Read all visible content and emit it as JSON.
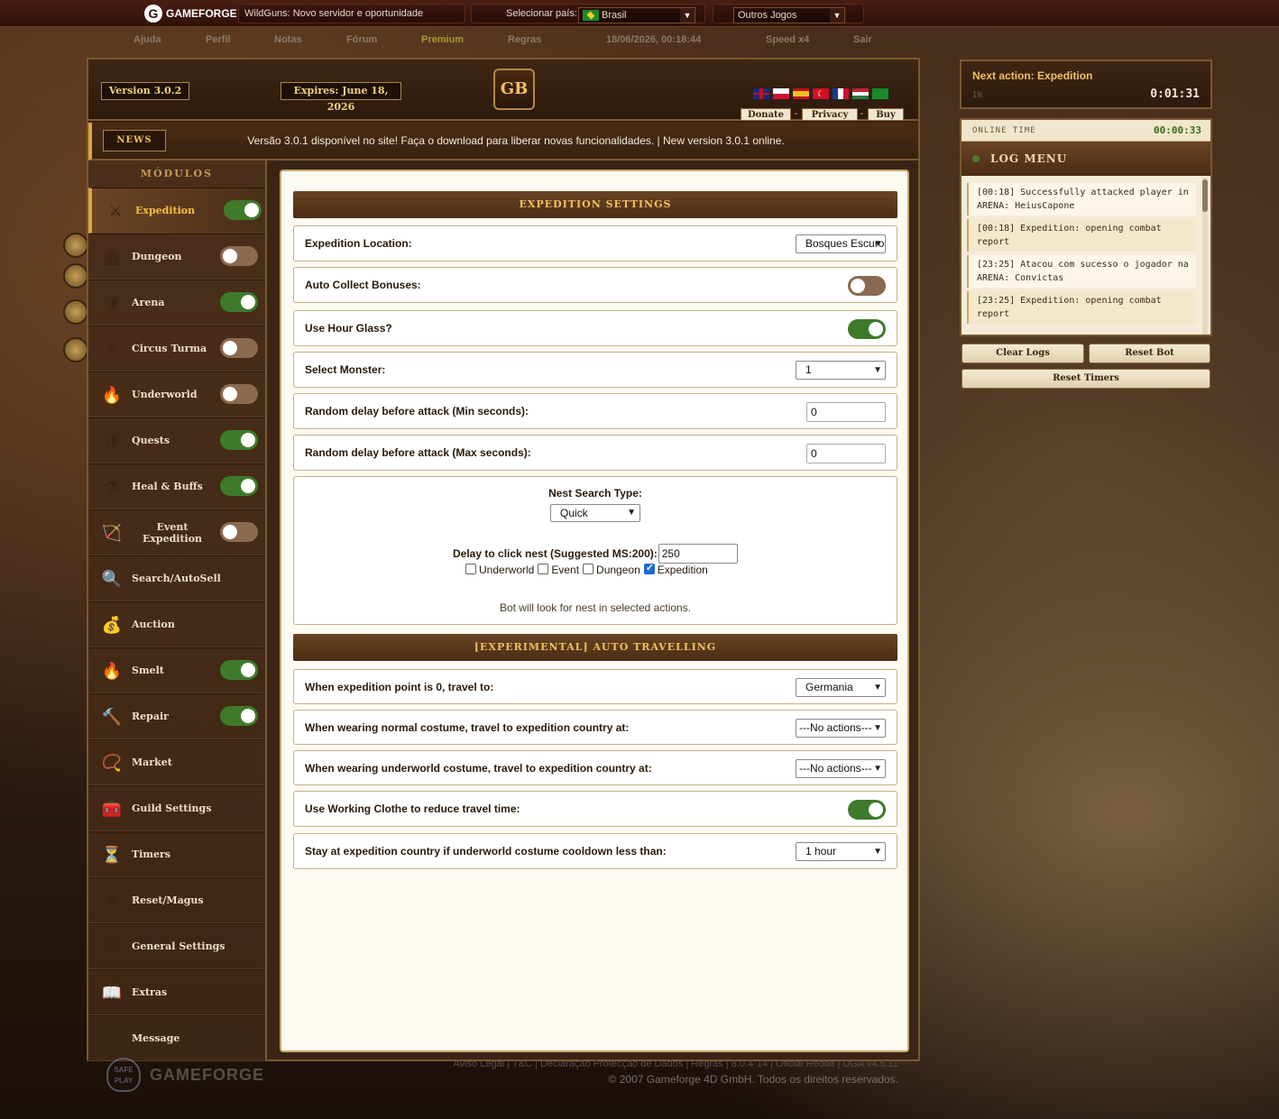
{
  "topbar": {
    "brand": "GAMEFORGE",
    "news_ticker": "WildGuns: Novo servidor e oportunidade",
    "country_label": "Selecionar país:",
    "country_value": "Brasil",
    "other_games": "Outros Jogos"
  },
  "gamenav": {
    "items": [
      "Ajuda",
      "Perfil",
      "Notas",
      "Fórum",
      "Premium",
      "Regras",
      "18/06/2026, 00:18:44",
      "Speed x4",
      "Sair"
    ]
  },
  "header": {
    "version": "Version 3.0.2",
    "expires": "Expires: June 18, 2026",
    "logo": "GB",
    "flags": [
      "uk",
      "pl",
      "es",
      "tr",
      "fr",
      "hu",
      "br"
    ],
    "links": {
      "donate": "Donate",
      "privacy": "Privacy",
      "buy": "Buy",
      "sep": "-"
    }
  },
  "news": {
    "button": "NEWS",
    "text": "Versão 3.0.1 disponível no site! Faça o download para liberar novas funcionalidades. | New version 3.0.1 online."
  },
  "sidebar": {
    "title": "MÓDULOS",
    "items": [
      {
        "label": "Expedition",
        "icon": "expedition-icon",
        "glyph": "⚔",
        "toggle": true,
        "on": true,
        "active": true
      },
      {
        "label": "Dungeon",
        "icon": "dungeon-icon",
        "glyph": "🏛",
        "toggle": true,
        "on": false
      },
      {
        "label": "Arena",
        "icon": "arena-icon",
        "glyph": "🛡",
        "toggle": true,
        "on": true
      },
      {
        "label": "Circus Turma",
        "icon": "circus-turma-icon",
        "glyph": "⚜",
        "toggle": true,
        "on": false
      },
      {
        "label": "Underworld",
        "icon": "underworld-icon",
        "glyph": "🔥",
        "toggle": true,
        "on": false
      },
      {
        "label": "Quests",
        "icon": "quests-icon",
        "glyph": "🛡",
        "toggle": true,
        "on": true
      },
      {
        "label": "Heal & Buffs",
        "icon": "potion-icon",
        "glyph": "⚗",
        "toggle": true,
        "on": true
      },
      {
        "label": "Event Expedition",
        "icon": "event-expedition-icon",
        "glyph": "🏹",
        "toggle": true,
        "on": false
      },
      {
        "label": "Search/AutoSell",
        "icon": "magnifier-icon",
        "glyph": "🔍",
        "toggle": false
      },
      {
        "label": "Auction",
        "icon": "money-bag-icon",
        "glyph": "💰",
        "toggle": false
      },
      {
        "label": "Smelt",
        "icon": "fire-icon",
        "glyph": "🔥",
        "toggle": true,
        "on": true
      },
      {
        "label": "Repair",
        "icon": "hammer-icon",
        "glyph": "🔨",
        "toggle": true,
        "on": true
      },
      {
        "label": "Market",
        "icon": "necklace-icon",
        "glyph": "📿",
        "toggle": false
      },
      {
        "label": "Guild Settings",
        "icon": "chest-icon",
        "glyph": "🧰",
        "toggle": false
      },
      {
        "label": "Timers",
        "icon": "hourglass-icon",
        "glyph": "⏳",
        "toggle": false
      },
      {
        "label": "Reset/Magus",
        "icon": "anvil-icon",
        "glyph": "⚒",
        "toggle": false
      },
      {
        "label": "General Settings",
        "icon": "gear-icon",
        "glyph": "⚙",
        "toggle": false
      },
      {
        "label": "Extras",
        "icon": "book-icon",
        "glyph": "📖",
        "toggle": false
      },
      {
        "label": "Message",
        "icon": "message-icon",
        "glyph": "✉",
        "toggle": false
      }
    ]
  },
  "expedition": {
    "section_title": "EXPEDITION SETTINGS",
    "location_label": "Expedition Location:",
    "location_value": "Bosques Escuros",
    "auto_collect_label": "Auto Collect Bonuses:",
    "auto_collect_on": false,
    "hour_glass_label": "Use Hour Glass?",
    "hour_glass_on": true,
    "monster_label": "Select Monster:",
    "monster_value": "1",
    "delay_min_label": "Random delay before attack (Min seconds):",
    "delay_min_value": "0",
    "delay_max_label": "Random delay before attack (Max seconds):",
    "delay_max_value": "0"
  },
  "nest": {
    "type_label": "Nest Search Type:",
    "type_value": "Quick",
    "delay_label": "Delay to click nest (Suggested MS:200):",
    "delay_value": "250",
    "checks": [
      {
        "label": "Underworld",
        "checked": false
      },
      {
        "label": "Event",
        "checked": false
      },
      {
        "label": "Dungeon",
        "checked": false
      },
      {
        "label": "Expedition",
        "checked": true
      }
    ],
    "note": "Bot will look for nest in selected actions."
  },
  "travel": {
    "section_title": "[EXPERIMENTAL] AUTO TRAVELLING",
    "zero_points_label": "When expedition point is 0, travel to:",
    "zero_points_value": "Germania",
    "normal_costume_label": "When wearing normal costume, travel to expedition country at:",
    "normal_costume_value": "---No actions---",
    "underworld_costume_label": "When wearing underworld costume, travel to expedition country at:",
    "underworld_costume_value": "---No actions---",
    "working_clothe_label": "Use Working Clothe to reduce travel time:",
    "working_clothe_on": true,
    "stay_label": "Stay at expedition country if underworld costume cooldown less than:",
    "stay_value": "1 hour"
  },
  "next_action": {
    "title": "Next action: Expedition",
    "in_label": "IN",
    "time": "0:01:31"
  },
  "log": {
    "online_label": "ONLINE TIME",
    "online_value": "00:00:33",
    "title": "LOG MENU",
    "entries": [
      "[00:18] Successfully attacked player in ARENA: HeiusCapone",
      "[00:18] Expedition: opening combat report",
      "[23:25] Atacou com sucesso o jogador na ARENA: Convictas",
      "[23:25] Expedition: opening combat report"
    ],
    "clear": "Clear Logs",
    "reset_bot": "Reset Bot",
    "reset_timers": "Reset Timers"
  },
  "footer": {
    "safe_play": "SAFE PLAY",
    "brand": "GAMEFORGE",
    "links": "Aviso Legal | T&C | Declaração Protecção de Dados | Regras | 8.0.4-14 | Oficial Reddit | UGA v4.5.11",
    "copyright": "© 2007 Gameforge 4D GmbH. Todos os direitos reservados."
  },
  "colors": {
    "accent_gold": "#f0c060",
    "toggle_on": "#3e7a2a",
    "toggle_off": "#8a6a50",
    "panel_brown": "#4a2c14"
  }
}
